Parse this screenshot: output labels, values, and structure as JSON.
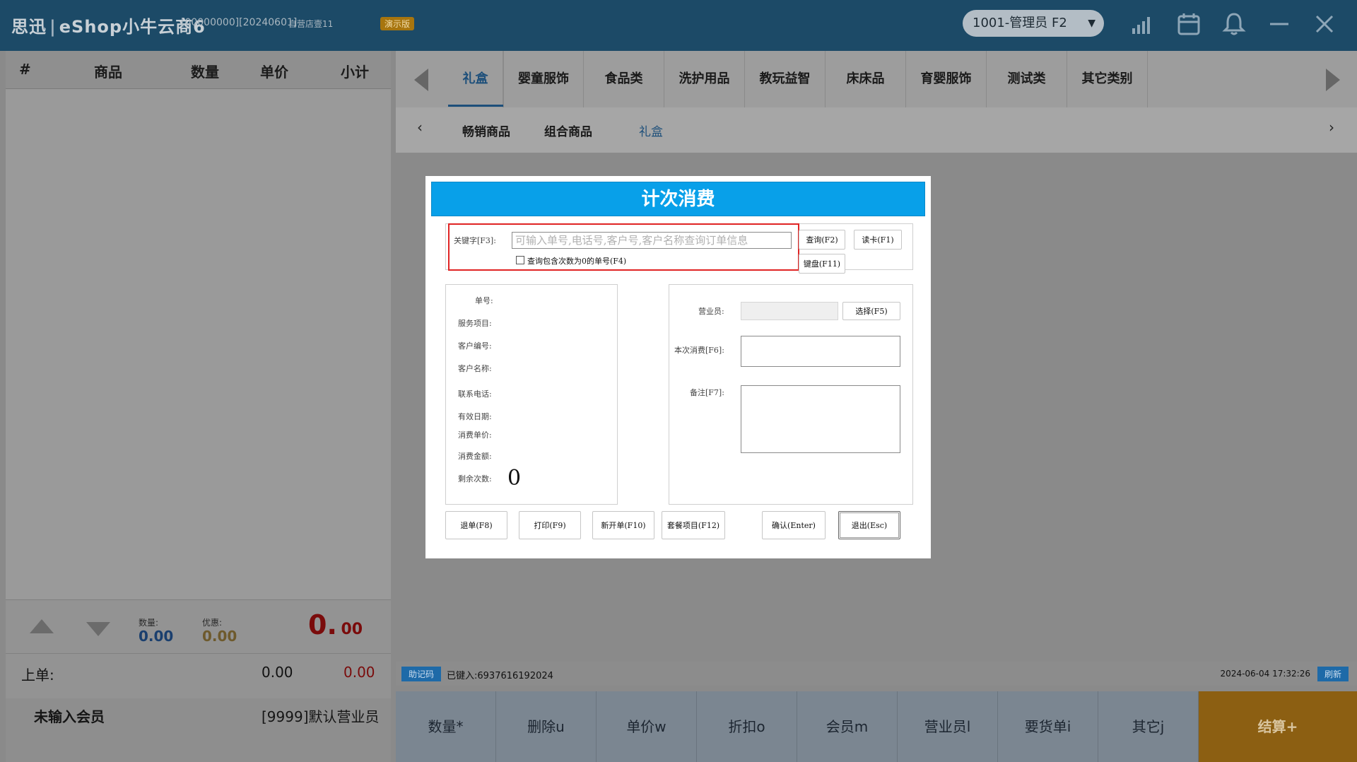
{
  "titlebar": {
    "brand_a": "思迅",
    "brand_b": "eShop小牛云商6",
    "meta": "[00000000][20240601]",
    "store": "自营店壹11",
    "demo_badge": "演示版",
    "user_selector": "1001-管理员 F2"
  },
  "cart": {
    "headers": [
      "#",
      "商品",
      "数量",
      "单价",
      "小计"
    ],
    "qty_label": "数量:",
    "qty_value": "0.00",
    "discount_label": "优惠:",
    "discount_value": "0.00",
    "total_int": "0.",
    "total_dec": "00",
    "prev_label": "上单:",
    "prev_amount": "0.00",
    "prev_total": "0.00",
    "member_text": "未输入会员",
    "clerk_text": "[9999]默认营业员"
  },
  "categories": [
    "礼盒",
    "婴童服饰",
    "食品类",
    "洗护用品",
    "教玩益智",
    "床床品",
    "育婴服饰",
    "测试类",
    "其它类别"
  ],
  "subcategories": [
    "畅销商品",
    "组合商品",
    "礼盒"
  ],
  "status": {
    "zjm_label": "助记码",
    "entered": "已键入:6937616192024",
    "datetime": "2024-06-04 17:32:26",
    "refresh": "刷新"
  },
  "function_keys": [
    "数量*",
    "删除u",
    "单价w",
    "折扣o",
    "会员m",
    "营业员l",
    "要货单i",
    "其它j"
  ],
  "settle_label": "结算+",
  "dialog": {
    "title": "计次消费",
    "keyword_label": "关键字[F3]:",
    "keyword_placeholder": "可输入单号,电话号,客户号,客户名称查询订单信息",
    "zero_check_label": "查询包含次数为0的单号(F4)",
    "query_btn": "查询(F2)",
    "readcard_btn": "读卡(F1)",
    "keyboard_btn": "键盘(F11)",
    "fields": [
      "单号:",
      "服务项目:",
      "客户编号:",
      "客户名称:",
      "联系电话:",
      "有效日期:",
      "消费单价:",
      "消费金额:",
      "剩余次数:"
    ],
    "remaining_value": "0",
    "clerk_label": "营业员:",
    "select_btn": "选择(F5)",
    "consume_label": "本次消费[F6]:",
    "note_label": "备注[F7]:",
    "buttons": {
      "refund": "退单(F8)",
      "print": "打印(F9)",
      "new_order": "新开单(F10)",
      "package": "套餐项目(F12)",
      "confirm": "确认(Enter)",
      "exit": "退出(Esc)"
    }
  },
  "colors": {
    "titlebar": "#1c4a67",
    "dialog_header": "#08a0e9",
    "highlight_box": "#e02424",
    "total_red": "#7a0b0b",
    "settle": "#8c5f12"
  },
  "icons": [
    "signal-icon",
    "calendar-icon",
    "bell-icon",
    "minimize-icon",
    "close-icon"
  ]
}
